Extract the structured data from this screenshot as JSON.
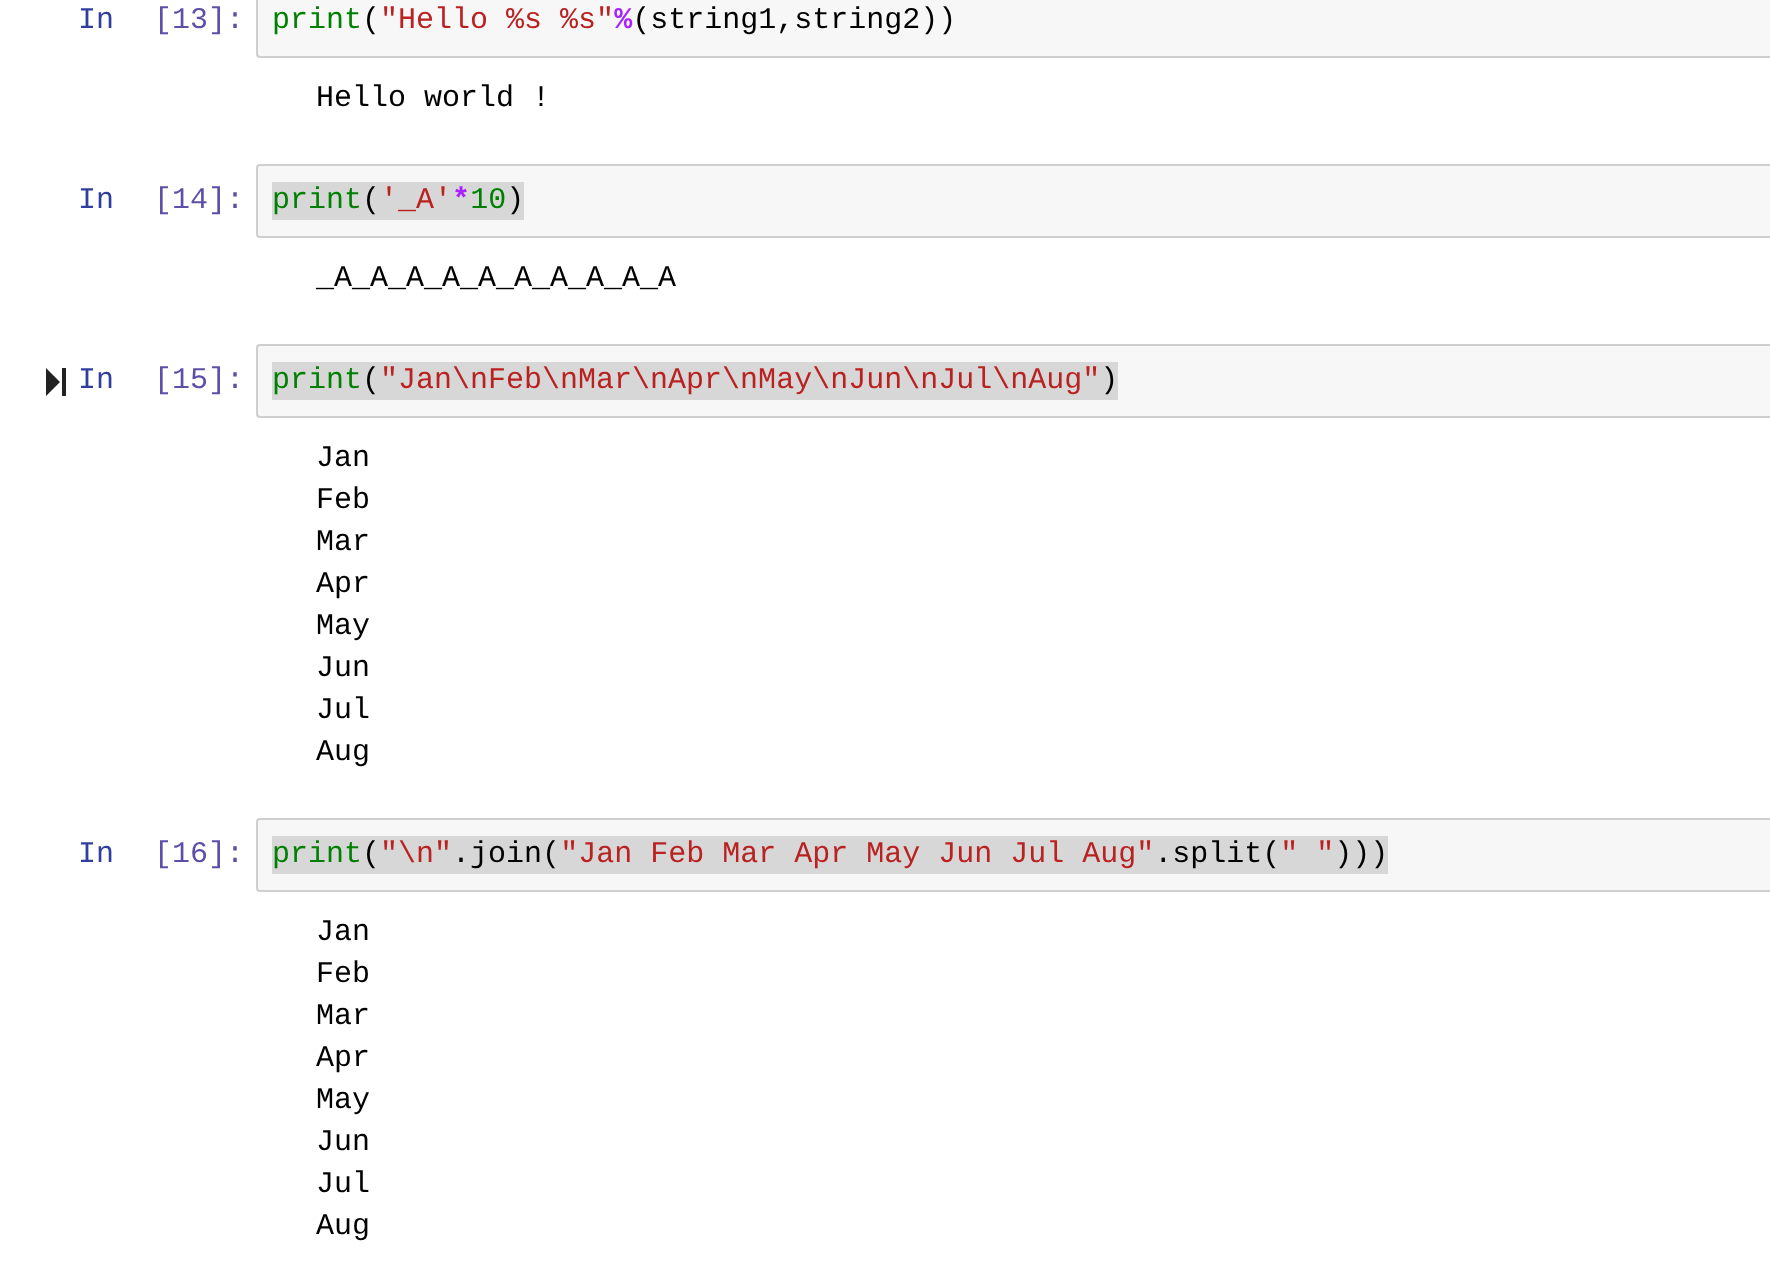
{
  "cells": [
    {
      "prompt": "In",
      "number": "[13]:",
      "current": false,
      "highlighted": false,
      "code": [
        {
          "kind": "builtin",
          "text": "print"
        },
        {
          "kind": "plain",
          "text": "("
        },
        {
          "kind": "string",
          "text": "\"Hello %s %s\""
        },
        {
          "kind": "operator",
          "text": "%"
        },
        {
          "kind": "plain",
          "text": "(string1,string2))"
        }
      ],
      "output": [
        "Hello world !"
      ]
    },
    {
      "prompt": "In",
      "number": "[14]:",
      "current": false,
      "highlighted": true,
      "code": [
        {
          "kind": "builtin",
          "text": "print"
        },
        {
          "kind": "plain",
          "text": "("
        },
        {
          "kind": "string",
          "text": "'_A'"
        },
        {
          "kind": "operator",
          "text": "*"
        },
        {
          "kind": "number",
          "text": "10"
        },
        {
          "kind": "plain",
          "text": ")"
        }
      ],
      "output": [
        "_A_A_A_A_A_A_A_A_A_A"
      ]
    },
    {
      "prompt": "In",
      "number": "[15]:",
      "current": true,
      "highlighted": true,
      "code": [
        {
          "kind": "builtin",
          "text": "print"
        },
        {
          "kind": "plain",
          "text": "("
        },
        {
          "kind": "string",
          "text": "\"Jan\\nFeb\\nMar\\nApr\\nMay\\nJun\\nJul\\nAug\""
        },
        {
          "kind": "plain",
          "text": ")"
        }
      ],
      "output": [
        "Jan",
        "Feb",
        "Mar",
        "Apr",
        "May",
        "Jun",
        "Jul",
        "Aug"
      ]
    },
    {
      "prompt": "In",
      "number": "[16]:",
      "current": false,
      "highlighted": true,
      "code": [
        {
          "kind": "builtin",
          "text": "print"
        },
        {
          "kind": "plain",
          "text": "("
        },
        {
          "kind": "string",
          "text": "\"\\n\""
        },
        {
          "kind": "plain",
          "text": ".join("
        },
        {
          "kind": "string",
          "text": "\"Jan Feb Mar Apr May Jun Jul Aug\""
        },
        {
          "kind": "plain",
          "text": ".split("
        },
        {
          "kind": "string",
          "text": "\" \""
        },
        {
          "kind": "plain",
          "text": ")))"
        }
      ],
      "output": [
        "Jan",
        "Feb",
        "Mar",
        "Apr",
        "May",
        "Jun",
        "Jul",
        "Aug"
      ]
    }
  ]
}
